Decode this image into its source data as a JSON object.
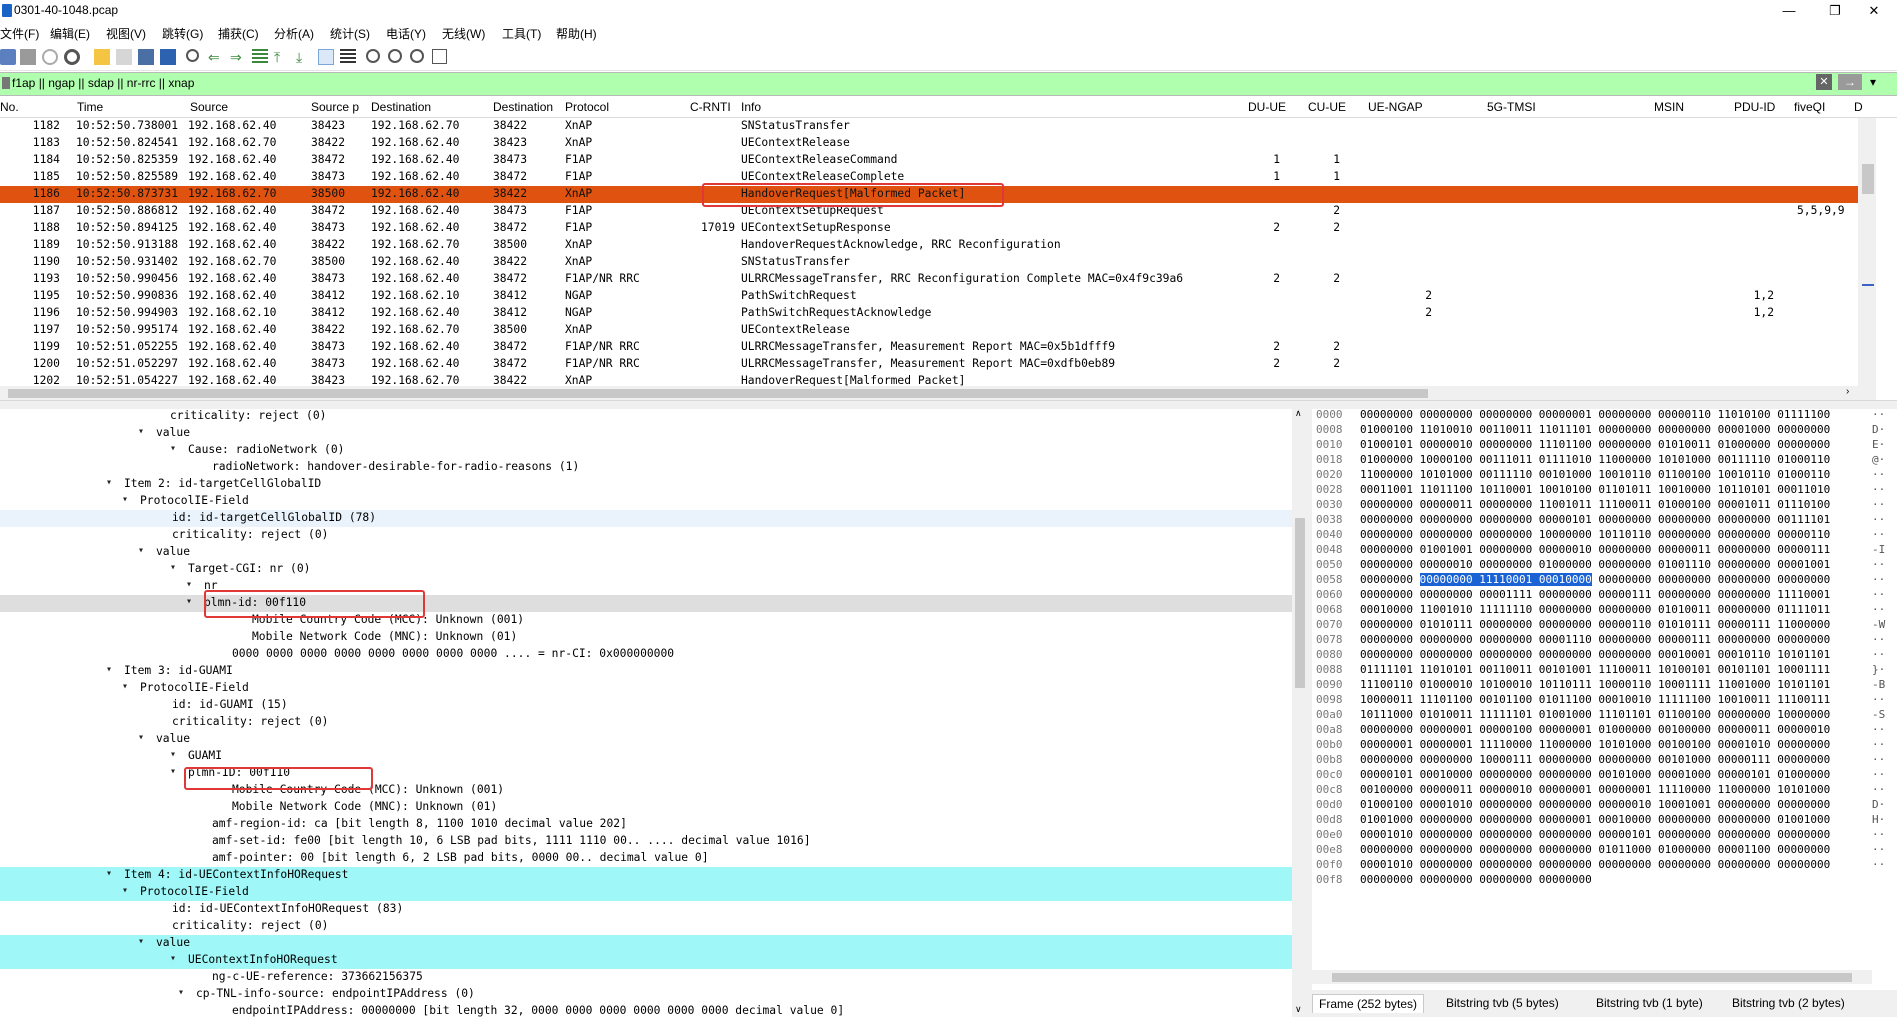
{
  "window": {
    "title": "0301-40-1048.pcap",
    "minimize": "—",
    "restore": "❐",
    "close": "✕"
  },
  "menu": [
    "文件(F)",
    "编辑(E)",
    "视图(V)",
    "跳转(G)",
    "捕获(C)",
    "分析(A)",
    "统计(S)",
    "电话(Y)",
    "无线(W)",
    "工具(T)",
    "帮助(H)"
  ],
  "filter": {
    "value": "f1ap || ngap || sdap || nr-rrc || xnap",
    "clear_icon": "✕",
    "apply_icon": "→",
    "dropdown_icon": "▾"
  },
  "columns": [
    "No.",
    "Time",
    "Source",
    "Source p",
    "Destination",
    "Destination",
    "Protocol",
    "C-RNTI",
    "Info",
    "DU-UE",
    "CU-UE",
    "UE-NGAP",
    "5G-TMSI",
    "MSIN",
    "PDU-ID",
    "fiveQI",
    "D"
  ],
  "packets": [
    {
      "no": "1182",
      "time": "10:52:50.738001",
      "src": "192.168.62.40",
      "sport": "38423",
      "dst": "192.168.62.70",
      "dport": "38422",
      "proto": "XnAP",
      "crnti": "",
      "info": "SNStatusTransfer",
      "du": "",
      "cu": "",
      "ngap": "",
      "pdu": "",
      "fiveqi": ""
    },
    {
      "no": "1183",
      "time": "10:52:50.824541",
      "src": "192.168.62.70",
      "sport": "38422",
      "dst": "192.168.62.40",
      "dport": "38423",
      "proto": "XnAP",
      "crnti": "",
      "info": "UEContextRelease",
      "du": "",
      "cu": "",
      "ngap": "",
      "pdu": "",
      "fiveqi": ""
    },
    {
      "no": "1184",
      "time": "10:52:50.825359",
      "src": "192.168.62.40",
      "sport": "38472",
      "dst": "192.168.62.40",
      "dport": "38473",
      "proto": "F1AP",
      "crnti": "",
      "info": "UEContextReleaseCommand",
      "du": "1",
      "cu": "1",
      "ngap": "",
      "pdu": "",
      "fiveqi": ""
    },
    {
      "no": "1185",
      "time": "10:52:50.825589",
      "src": "192.168.62.40",
      "sport": "38473",
      "dst": "192.168.62.40",
      "dport": "38472",
      "proto": "F1AP",
      "crnti": "",
      "info": "UEContextReleaseComplete",
      "du": "1",
      "cu": "1",
      "ngap": "",
      "pdu": "",
      "fiveqi": ""
    },
    {
      "no": "1186",
      "time": "10:52:50.873731",
      "src": "192.168.62.70",
      "sport": "38500",
      "dst": "192.168.62.40",
      "dport": "38422",
      "proto": "XnAP",
      "crnti": "",
      "info": "HandoverRequest[Malformed Packet]",
      "du": "",
      "cu": "",
      "ngap": "",
      "pdu": "",
      "fiveqi": ""
    },
    {
      "no": "1187",
      "time": "10:52:50.886812",
      "src": "192.168.62.40",
      "sport": "38472",
      "dst": "192.168.62.40",
      "dport": "38473",
      "proto": "F1AP",
      "crnti": "",
      "info": "UEContextSetupRequest",
      "du": "",
      "cu": "2",
      "ngap": "",
      "pdu": "",
      "fiveqi": "5,5,9,9"
    },
    {
      "no": "1188",
      "time": "10:52:50.894125",
      "src": "192.168.62.40",
      "sport": "38473",
      "dst": "192.168.62.40",
      "dport": "38472",
      "proto": "F1AP",
      "crnti": "17019",
      "info": "UEContextSetupResponse",
      "du": "2",
      "cu": "2",
      "ngap": "",
      "pdu": "",
      "fiveqi": ""
    },
    {
      "no": "1189",
      "time": "10:52:50.913188",
      "src": "192.168.62.40",
      "sport": "38422",
      "dst": "192.168.62.70",
      "dport": "38500",
      "proto": "XnAP",
      "crnti": "",
      "info": "HandoverRequestAcknowledge, RRC Reconfiguration",
      "du": "",
      "cu": "",
      "ngap": "",
      "pdu": "",
      "fiveqi": ""
    },
    {
      "no": "1190",
      "time": "10:52:50.931402",
      "src": "192.168.62.70",
      "sport": "38500",
      "dst": "192.168.62.40",
      "dport": "38422",
      "proto": "XnAP",
      "crnti": "",
      "info": "SNStatusTransfer",
      "du": "",
      "cu": "",
      "ngap": "",
      "pdu": "",
      "fiveqi": ""
    },
    {
      "no": "1193",
      "time": "10:52:50.990456",
      "src": "192.168.62.40",
      "sport": "38473",
      "dst": "192.168.62.40",
      "dport": "38472",
      "proto": "F1AP/NR RRC",
      "crnti": "",
      "info": "ULRRCMessageTransfer, RRC Reconfiguration Complete MAC=0x4f9c39a6",
      "du": "2",
      "cu": "2",
      "ngap": "",
      "pdu": "",
      "fiveqi": ""
    },
    {
      "no": "1195",
      "time": "10:52:50.990836",
      "src": "192.168.62.40",
      "sport": "38412",
      "dst": "192.168.62.10",
      "dport": "38412",
      "proto": "NGAP",
      "crnti": "",
      "info": "PathSwitchRequest",
      "du": "",
      "cu": "",
      "ngap": "2",
      "pdu": "1,2",
      "fiveqi": ""
    },
    {
      "no": "1196",
      "time": "10:52:50.994903",
      "src": "192.168.62.10",
      "sport": "38412",
      "dst": "192.168.62.40",
      "dport": "38412",
      "proto": "NGAP",
      "crnti": "",
      "info": "PathSwitchRequestAcknowledge",
      "du": "",
      "cu": "",
      "ngap": "2",
      "pdu": "1,2",
      "fiveqi": ""
    },
    {
      "no": "1197",
      "time": "10:52:50.995174",
      "src": "192.168.62.40",
      "sport": "38422",
      "dst": "192.168.62.70",
      "dport": "38500",
      "proto": "XnAP",
      "crnti": "",
      "info": "UEContextRelease",
      "du": "",
      "cu": "",
      "ngap": "",
      "pdu": "",
      "fiveqi": ""
    },
    {
      "no": "1199",
      "time": "10:52:51.052255",
      "src": "192.168.62.40",
      "sport": "38473",
      "dst": "192.168.62.40",
      "dport": "38472",
      "proto": "F1AP/NR RRC",
      "crnti": "",
      "info": "ULRRCMessageTransfer, Measurement Report MAC=0x5b1dfff9",
      "du": "2",
      "cu": "2",
      "ngap": "",
      "pdu": "",
      "fiveqi": ""
    },
    {
      "no": "1200",
      "time": "10:52:51.052297",
      "src": "192.168.62.40",
      "sport": "38473",
      "dst": "192.168.62.40",
      "dport": "38472",
      "proto": "F1AP/NR RRC",
      "crnti": "",
      "info": "ULRRCMessageTransfer, Measurement Report MAC=0xdfb0eb89",
      "du": "2",
      "cu": "2",
      "ngap": "",
      "pdu": "",
      "fiveqi": ""
    },
    {
      "no": "1202",
      "time": "10:52:51.054227",
      "src": "192.168.62.40",
      "sport": "38423",
      "dst": "192.168.62.70",
      "dport": "38422",
      "proto": "XnAP",
      "crnti": "",
      "info": "HandoverRequest[Malformed Packet]",
      "du": "",
      "cu": "",
      "ngap": "",
      "pdu": "",
      "fiveqi": ""
    }
  ],
  "details": [
    {
      "t": "criticality: reject (0)"
    },
    {
      "t": "value",
      "exp": "▾"
    },
    {
      "t": "Cause: radioNetwork (0)",
      "exp": "▾"
    },
    {
      "t": "radioNetwork: handover-desirable-for-radio-reasons (1)"
    },
    {
      "t": "Item 2: id-targetCellGlobalID",
      "exp": "▾"
    },
    {
      "t": "ProtocolIE-Field",
      "exp": "▾"
    },
    {
      "t": "id: id-targetCellGlobalID (78)"
    },
    {
      "t": "criticality: reject (0)"
    },
    {
      "t": "value",
      "exp": "▾"
    },
    {
      "t": "Target-CGI: nr (0)",
      "exp": "▾"
    },
    {
      "t": "nr",
      "exp": "▾"
    },
    {
      "t": "plmn-id: 00f110",
      "exp": "▾"
    },
    {
      "t": "Mobile Country Code (MCC): Unknown (001)"
    },
    {
      "t": "Mobile Network Code (MNC): Unknown (01)"
    },
    {
      "t": "0000 0000 0000 0000 0000 0000 0000 0000 .... = nr-CI: 0x000000000"
    },
    {
      "t": "Item 3: id-GUAMI",
      "exp": "▾"
    },
    {
      "t": "ProtocolIE-Field",
      "exp": "▾"
    },
    {
      "t": "id: id-GUAMI (15)"
    },
    {
      "t": "criticality: reject (0)"
    },
    {
      "t": "value",
      "exp": "▾"
    },
    {
      "t": "GUAMI",
      "exp": "▾"
    },
    {
      "t": "plmn-ID: 00f110",
      "exp": "▾"
    },
    {
      "t": "Mobile Country Code (MCC): Unknown (001)"
    },
    {
      "t": "Mobile Network Code (MNC): Unknown (01)"
    },
    {
      "t": "amf-region-id: ca [bit length 8, 1100 1010 decimal value 202]"
    },
    {
      "t": "amf-set-id: fe00 [bit length 10, 6 LSB pad bits, 1111 1110  00.. .... decimal value 1016]"
    },
    {
      "t": "amf-pointer: 00 [bit length 6, 2 LSB pad bits, 0000 00.. decimal value 0]"
    },
    {
      "t": "Item 4: id-UEContextInfoHORequest",
      "exp": "▾"
    },
    {
      "t": "ProtocolIE-Field",
      "exp": "▾"
    },
    {
      "t": "id: id-UEContextInfoHORequest (83)"
    },
    {
      "t": "criticality: reject (0)"
    },
    {
      "t": "value",
      "exp": "▾"
    },
    {
      "t": "UEContextInfoHORequest",
      "exp": "▾"
    },
    {
      "t": "ng-c-UE-reference: 373662156375"
    },
    {
      "t": "cp-TNL-info-source: endpointIPAddress (0)",
      "exp": "▾"
    },
    {
      "t": "endpointIPAddress: 00000000 [bit length 32, 0000 0000  0000 0000  0000 0000 decimal value 0]"
    }
  ],
  "bytes": [
    {
      "off": "0000",
      "bits": "00000000 00000000 00000000 00000001 00000000 00000110 11010100 01111100",
      "asc": "··"
    },
    {
      "off": "0008",
      "bits": "01000100 11010010 00110011 11011101 00000000 00000000 00001000 00000000",
      "asc": "D·"
    },
    {
      "off": "0010",
      "bits": "01000101 00000010 00000000 11101100 00000000 01010011 01000000 00000000",
      "asc": "E·"
    },
    {
      "off": "0018",
      "bits": "01000000 10000100 00111011 01111010 11000000 10101000 00111110 01000110",
      "asc": "@·"
    },
    {
      "off": "0020",
      "bits": "11000000 10101000 00111110 00101000 10010110 01100100 10010110 01000110",
      "asc": "··"
    },
    {
      "off": "0028",
      "bits": "00011001 11011100 10110001 10010100 01101011 10010000 10110101 00011010",
      "asc": "··"
    },
    {
      "off": "0030",
      "bits": "00000000 00000011 00000000 11001011 11100011 01000100 00001011 01110100",
      "asc": "··"
    },
    {
      "off": "0038",
      "bits": "00000000 00000000 00000000 00000101 00000000 00000000 00000000 00111101",
      "asc": "··"
    },
    {
      "off": "0040",
      "bits": "00000000 00000000 00000000 10000000 10110110 00000000 00000000 00000110",
      "asc": "··"
    },
    {
      "off": "0048",
      "bits": "00000000 01001001 00000000 00000010 00000000 00000011 00000000 00000111",
      "asc": "-I"
    },
    {
      "off": "0050",
      "bits": "00000000 00000010 00000000 01000000 00000000 01001110 00000000 00001001",
      "asc": "··"
    },
    {
      "off": "0058",
      "bits": "00000000 00000000 11110001 00010000 00000000 00000000 00000000 00000000",
      "asc": "··",
      "sel": true
    },
    {
      "off": "0060",
      "bits": "00000000 00000000 00001111 00000000 00000111 00000000 00000000 11110001",
      "asc": "··"
    },
    {
      "off": "0068",
      "bits": "00010000 11001010 11111110 00000000 00000000 01010011 00000000 01111011",
      "asc": "··"
    },
    {
      "off": "0070",
      "bits": "00000000 01010111 00000000 00000000 00000110 01010111 00000111 11000000",
      "asc": "-W"
    },
    {
      "off": "0078",
      "bits": "00000000 00000000 00000000 00001110 00000000 00000111 00000000 00000000",
      "asc": "··"
    },
    {
      "off": "0080",
      "bits": "00000000 00000000 00000000 00000000 00000000 00010001 00010110 10101101",
      "asc": "··"
    },
    {
      "off": "0088",
      "bits": "01111101 11010101 00110011 00101001 11100011 10100101 00101101 10001111",
      "asc": "}·"
    },
    {
      "off": "0090",
      "bits": "11100110 01000010 10100010 10110111 10000110 10001111 11001000 10101101",
      "asc": "-B"
    },
    {
      "off": "0098",
      "bits": "10000011 11101100 00101100 01011100 00010010 11111100 10010011 11100111",
      "asc": "··"
    },
    {
      "off": "00a0",
      "bits": "10111000 01010011 11111101 01001000 11101101 01100100 00000000 10000000",
      "asc": "-S"
    },
    {
      "off": "00a8",
      "bits": "00000000 00000001 00000100 00000001 01000000 00100000 00000011 00000010",
      "asc": "··"
    },
    {
      "off": "00b0",
      "bits": "00000001 00000001 11110000 11000000 10101000 00100100 00001010 00000000",
      "asc": "··"
    },
    {
      "off": "00b8",
      "bits": "00000000 00000000 10000111 00000000 00000000 00101000 00000111 00000000",
      "asc": "··"
    },
    {
      "off": "00c0",
      "bits": "00000101 00010000 00000000 00000000 00101000 00001000 00000101 01000000",
      "asc": "··"
    },
    {
      "off": "00c8",
      "bits": "00100000 00000011 00000010 00000001 00000001 11110000 11000000 10101000",
      "asc": "··"
    },
    {
      "off": "00d0",
      "bits": "01000100 00001010 00000000 00000000 00000010 10001001 00000000 00000000",
      "asc": "D·"
    },
    {
      "off": "00d8",
      "bits": "01001000 00000000 00000000 00000001 00010000 00000000 00000000 01001000",
      "asc": "H·"
    },
    {
      "off": "00e0",
      "bits": "00001010 00000000 00000000 00000000 00000101 00000000 00000000 00000000",
      "asc": "··"
    },
    {
      "off": "00e8",
      "bits": "00000000 00000000 00000000 00000000 01011000 01000000 00001100 00000000",
      "asc": "··"
    },
    {
      "off": "00f0",
      "bits": "00001010 00000000 00000000 00000000 00000000 00000000 00000000 00000000",
      "asc": "··"
    },
    {
      "off": "00f8",
      "bits": "00000000 00000000 00000000 00000000",
      "asc": ""
    }
  ],
  "byte_sel_prefix": "00000000 ",
  "byte_sel_text": "00000000 11110001 00010000",
  "byte_sel_suffix": " 00000000 00000000 00000000 00000000",
  "byte_tabs": [
    "Frame (252 bytes)",
    "Bitstring tvb (5 bytes)",
    "Bitstring tvb (1 byte)",
    "Bitstring tvb (2 bytes)"
  ],
  "colors": {
    "selected_row": "#e0520f",
    "filter_bg": "#afffaf",
    "highlight_cyan": "#9ff7f7",
    "annotation_red": "#e23737"
  }
}
